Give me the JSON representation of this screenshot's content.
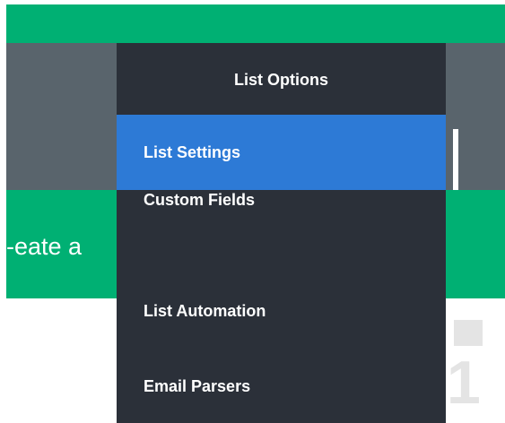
{
  "background": {
    "banner_text": "-eate a",
    "ghost_digit": "1"
  },
  "menu": {
    "title": "List Options",
    "items": [
      {
        "label": "List Settings",
        "active": true
      },
      {
        "label": "Custom Fields",
        "active": false
      },
      {
        "label": "List Automation",
        "active": false
      },
      {
        "label": "Email Parsers",
        "active": false
      }
    ]
  },
  "colors": {
    "brand_green": "#00b073",
    "header_gray": "#59646c",
    "menu_bg": "#2b3039",
    "active_blue": "#2d7ad6"
  }
}
